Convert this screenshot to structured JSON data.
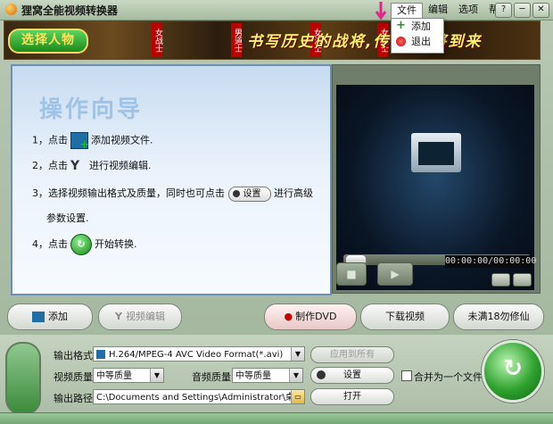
{
  "window": {
    "title": "狸窝全能视频转换器",
    "menu": [
      "文件",
      "编辑",
      "选项",
      "帮助"
    ],
    "buttons": [
      "?",
      "─",
      "✕"
    ]
  },
  "file_menu": {
    "items": [
      {
        "label": "添加",
        "icon": "add-icon"
      },
      {
        "label": "退出",
        "icon": "exit-icon"
      }
    ]
  },
  "banner": {
    "button_label": "选择人物",
    "tags": [
      "女战士",
      "男道士",
      "女法士",
      "女道士"
    ],
    "slogan": "书写历史的战将,传 刻即将到来"
  },
  "guide": {
    "title": "操作向导",
    "step1_pre": "1，点击",
    "step1_post": "添加视频文件.",
    "step2_pre": "2，点击",
    "step2_post": "进行视频编辑.",
    "step3_pre": "3，选择视频输出格式及质量，同时也可点击",
    "step3_btn": "设置",
    "step3_post": "进行高级",
    "step3_cont": "参数设置.",
    "step4_pre": "4，点击",
    "step4_post": "开始转换."
  },
  "player": {
    "timecode": "00:00:00/00:00:00",
    "progress": 0
  },
  "actions": {
    "add": "添加",
    "edit": "视频编辑",
    "dvd": "制作DVD",
    "download": "下载视频",
    "promo": "未满18勿修仙"
  },
  "output": {
    "format_label": "输出格式:",
    "format_value": "H.264/MPEG-4 AVC Video Format(*.avi)",
    "apply_all": "应用到所有",
    "video_quality_label": "视频质量:",
    "video_quality_value": "中等质量",
    "audio_quality_label": "音频质量:",
    "audio_quality_value": "中等质量",
    "settings_button": "设置",
    "merge_label": "合并为一个文件",
    "merge_checked": false,
    "path_label": "输出路径:",
    "path_value": "C:\\Documents and Settings\\Administrator\\桌面\\",
    "open_button": "打开"
  }
}
